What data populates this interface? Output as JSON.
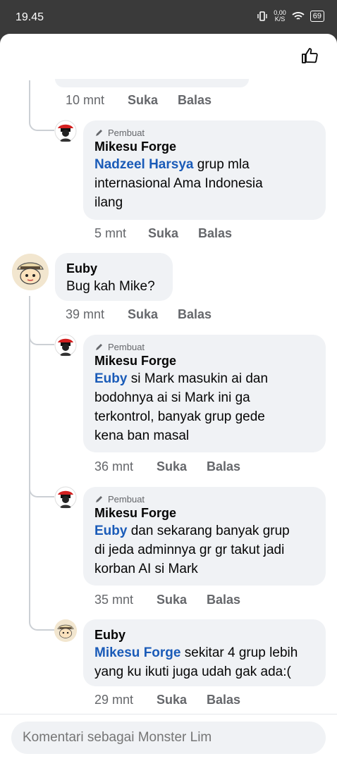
{
  "status_bar": {
    "time": "19.45",
    "net_speed": "0,00",
    "net_unit": "K/S",
    "battery": "69"
  },
  "partial_previous": {
    "text": "~ ~ ~ ~ ~ ~ ~ ~ ~ ~",
    "time": "10 mnt",
    "like": "Suka",
    "reply": "Balas"
  },
  "comments": [
    {
      "badge": "Pembuat",
      "author": "Mikesu Forge",
      "mention": "Nadzeel Harsya",
      "lines": [
        "grup mla",
        "internasional Ama Indonesia",
        "ilang"
      ],
      "time": "5 mnt",
      "like": "Suka",
      "reply": "Balas"
    },
    {
      "author": "Euby",
      "lines": [
        "Bug kah Mike?"
      ],
      "time": "39 mnt",
      "like": "Suka",
      "reply": "Balas"
    },
    {
      "badge": "Pembuat",
      "author": "Mikesu Forge",
      "mention": "Euby",
      "lines": [
        "si Mark masukin ai dan",
        "bodohnya ai si Mark ini ga",
        "terkontrol, banyak grup gede",
        "kena ban masal"
      ],
      "time": "36 mnt",
      "like": "Suka",
      "reply": "Balas"
    },
    {
      "badge": "Pembuat",
      "author": "Mikesu Forge",
      "mention": "Euby",
      "lines": [
        "dan sekarang banyak grup",
        "di jeda adminnya gr gr takut jadi",
        "korban AI si Mark"
      ],
      "time": "35 mnt",
      "like": "Suka",
      "reply": "Balas"
    },
    {
      "author": "Euby",
      "mention": "Mikesu Forge",
      "lines": [
        "sekitar 4 grup lebih",
        "yang ku ikuti juga udah gak ada:("
      ],
      "time": "29 mnt",
      "like": "Suka",
      "reply": "Balas"
    }
  ],
  "composer": {
    "placeholder": "Komentari sebagai Monster Lim"
  },
  "colors": {
    "mention": "#1a5bb8",
    "bubble": "#f0f2f5",
    "meta": "#65676b"
  }
}
